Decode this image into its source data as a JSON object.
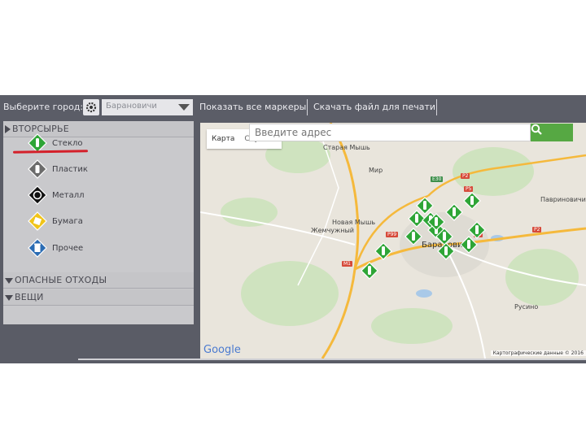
{
  "topbar": {
    "city_label": "Выберите город:",
    "city_value": "Барановичи",
    "show_all": "Показать все маркеры",
    "download": "Скачать файл для печати"
  },
  "sidebar": {
    "recyclables_header": "ВТОРСЫРЬЕ",
    "items": [
      {
        "label": "Стекло",
        "color": "#2ea536"
      },
      {
        "label": "Пластик",
        "color": "#6b6b6b"
      },
      {
        "label": "Металл",
        "color": "#111111"
      },
      {
        "label": "Бумага",
        "color": "#f0c419"
      },
      {
        "label": "Прочее",
        "color": "#2b6cb3"
      }
    ],
    "hazardous_header": "ОПАСНЫЕ ОТХОДЫ",
    "things_header": "ВЕЩИ"
  },
  "map": {
    "type_map": "Карта",
    "type_sat": "Спутник",
    "search_placeholder": "Введите адрес",
    "places": {
      "staraya_mysh": "Старая Мышь",
      "mir": "Мир",
      "novaya_mysh": "Новая Мышь",
      "zhemchuzhny": "Жемчужный",
      "baranovichi": "Барановичи",
      "zvonkovichi": "Павриновичи",
      "rusino": "Русино"
    },
    "roads": [
      "Е30",
      "Р2",
      "Р99",
      "Р5",
      "М1",
      "Р5",
      "Р2"
    ],
    "google": "Google",
    "attribution": "Картографические данные © 2016",
    "marker_color": "#2ea536"
  }
}
